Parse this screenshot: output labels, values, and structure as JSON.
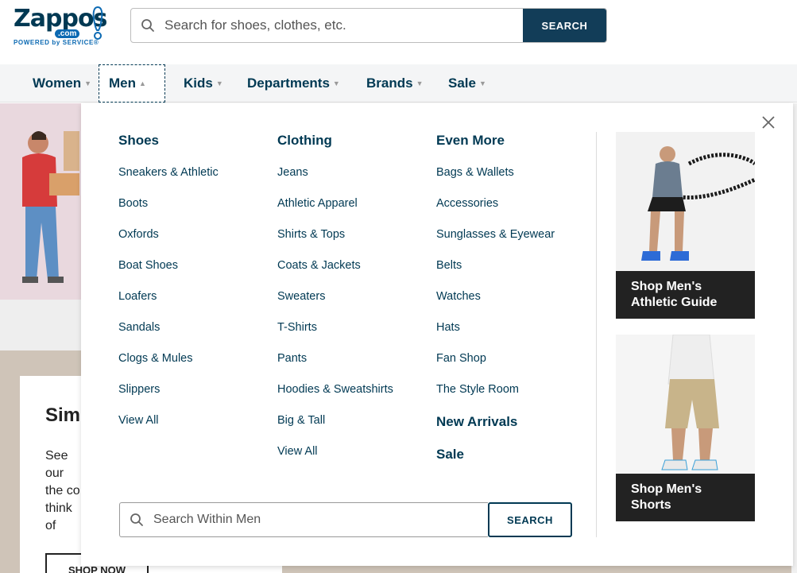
{
  "header": {
    "logo_word": "Zappos",
    "logo_com": ".com",
    "logo_tagline": "POWERED by SERVICE®",
    "search_placeholder": "Search for shoes, clothes, etc.",
    "search_button": "SEARCH"
  },
  "nav": {
    "items": [
      {
        "label": "Women"
      },
      {
        "label": "Men"
      },
      {
        "label": "Kids"
      },
      {
        "label": "Departments"
      },
      {
        "label": "Brands"
      },
      {
        "label": "Sale"
      }
    ],
    "active": "Men"
  },
  "background": {
    "card_title": "Sim",
    "card_text": "See our the co think of jogger Birken",
    "card_button": "SHOP NOW"
  },
  "dropdown": {
    "columns": [
      {
        "heading": "Shoes",
        "links": [
          "Sneakers & Athletic",
          "Boots",
          "Oxfords",
          "Boat Shoes",
          "Loafers",
          "Sandals",
          "Clogs & Mules",
          "Slippers",
          "View All"
        ]
      },
      {
        "heading": "Clothing",
        "links": [
          "Jeans",
          "Athletic Apparel",
          "Shirts & Tops",
          "Coats & Jackets",
          "Sweaters",
          "T-Shirts",
          "Pants",
          "Hoodies & Sweatshirts",
          "Big & Tall",
          "View All"
        ]
      },
      {
        "heading": "Even More",
        "links": [
          "Bags & Wallets",
          "Accessories",
          "Sunglasses & Eyewear",
          "Belts",
          "Watches",
          "Hats",
          "Fan Shop",
          "The Style Room"
        ],
        "subheadings": [
          "New Arrivals",
          "Sale"
        ]
      }
    ],
    "promos": [
      {
        "line1": "Shop Men's",
        "line2": "Athletic Guide"
      },
      {
        "line1": "Shop Men's",
        "line2": "Shorts"
      }
    ],
    "search_placeholder": "Search Within Men",
    "search_button": "SEARCH"
  },
  "colors": {
    "brand_navy": "#003953",
    "search_button": "#123d58",
    "logo_blue": "#0c6ab3"
  }
}
